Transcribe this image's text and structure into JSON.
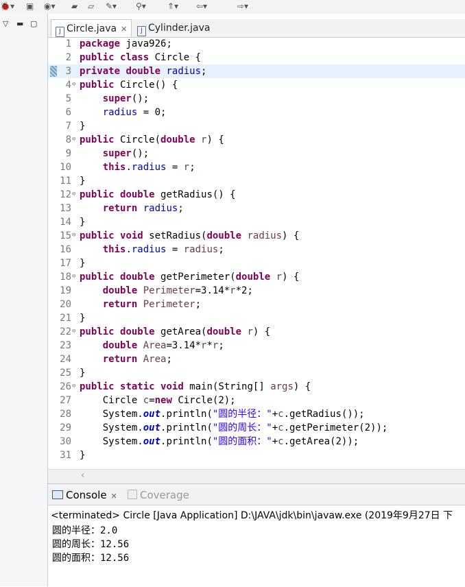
{
  "toolbar": {
    "icons": [
      "debug-icon",
      "package-icon",
      "run-icon",
      "open-folder-icon",
      "new-folder-icon",
      "tools-icon",
      "search-icon",
      "annotation-icon",
      "back-icon",
      "forward-icon"
    ]
  },
  "editor": {
    "tabs": [
      {
        "label": "Circle.java",
        "active": true
      },
      {
        "label": "Cylinder.java",
        "active": false
      }
    ],
    "highlighted_line": 3,
    "lines": [
      {
        "n": "1",
        "html": "<span class=\"k\">package</span> java926;"
      },
      {
        "n": "2",
        "html": "<span class=\"k\">public</span> <span class=\"k\">class</span> Circle {"
      },
      {
        "n": "3",
        "html": "<span class=\"k\">private</span> <span class=\"k\">double</span> <span class=\"f\">radius</span>;"
      },
      {
        "n": "4",
        "fold": true,
        "html": "<span class=\"k\">public</span> Circle() {"
      },
      {
        "n": "5",
        "html": "    <span class=\"k\">super</span>();"
      },
      {
        "n": "6",
        "html": "    <span class=\"f\">radius</span> = 0;"
      },
      {
        "n": "7",
        "html": "}"
      },
      {
        "n": "8",
        "fold": true,
        "html": "<span class=\"k\">public</span> Circle(<span class=\"k\">double</span> <span class=\"v\">r</span>) {"
      },
      {
        "n": "9",
        "html": "    <span class=\"k\">super</span>();"
      },
      {
        "n": "10",
        "html": "    <span class=\"k\">this</span>.<span class=\"f\">radius</span> = <span class=\"v\">r</span>;"
      },
      {
        "n": "11",
        "html": "}"
      },
      {
        "n": "12",
        "fold": true,
        "html": "<span class=\"k\">public</span> <span class=\"k\">double</span> getRadius() {"
      },
      {
        "n": "13",
        "html": "    <span class=\"k\">return</span> <span class=\"f\">radius</span>;"
      },
      {
        "n": "14",
        "html": "}"
      },
      {
        "n": "15",
        "fold": true,
        "html": "<span class=\"k\">public</span> <span class=\"k\">void</span> setRadius(<span class=\"k\">double</span> <span class=\"v\">radius</span>) {"
      },
      {
        "n": "16",
        "html": "    <span class=\"k\">this</span>.<span class=\"f\">radius</span> = <span class=\"v\">radius</span>;"
      },
      {
        "n": "17",
        "html": "}"
      },
      {
        "n": "18",
        "fold": true,
        "html": "<span class=\"k\">public</span> <span class=\"k\">double</span> getPerimeter(<span class=\"k\">double</span> <span class=\"v\">r</span>) {"
      },
      {
        "n": "19",
        "html": "    <span class=\"k\">double</span> <span class=\"v\">Perimeter</span>=3.14*<span class=\"v\">r</span>*2;"
      },
      {
        "n": "20",
        "html": "    <span class=\"k\">return</span> <span class=\"v\">Perimeter</span>;"
      },
      {
        "n": "21",
        "html": "}"
      },
      {
        "n": "22",
        "fold": true,
        "html": "<span class=\"k\">public</span> <span class=\"k\">double</span> getArea(<span class=\"k\">double</span> <span class=\"v\">r</span>) {"
      },
      {
        "n": "23",
        "html": "    <span class=\"k\">double</span> <span class=\"v\">Area</span>=3.14*<span class=\"v\">r</span>*<span class=\"v\">r</span>;"
      },
      {
        "n": "24",
        "html": "    <span class=\"k\">return</span> <span class=\"v\">Area</span>;"
      },
      {
        "n": "25",
        "html": "}"
      },
      {
        "n": "26",
        "fold": true,
        "html": "<span class=\"k\">public</span> <span class=\"k\">static</span> <span class=\"k\">void</span> main(String[] <span class=\"v\">args</span>) {"
      },
      {
        "n": "27",
        "html": "    Circle <span class=\"v\">c</span>=<span class=\"k\">new</span> Circle(2);"
      },
      {
        "n": "28",
        "html": "    System.<span class=\"o\">out</span>.println(<span class=\"s\">\"圆的半径：\"</span>+<span class=\"v\">c</span>.getRadius());"
      },
      {
        "n": "29",
        "html": "    System.<span class=\"o\">out</span>.println(<span class=\"s\">\"圆的周长：\"</span>+<span class=\"v\">c</span>.getPerimeter(2));"
      },
      {
        "n": "30",
        "html": "    System.<span class=\"o\">out</span>.println(<span class=\"s\">\"圆的面积：\"</span>+<span class=\"v\">c</span>.getArea(2));"
      },
      {
        "n": "31",
        "html": "}"
      }
    ]
  },
  "console": {
    "tabs": [
      {
        "label": "Console",
        "active": true
      },
      {
        "label": "Coverage",
        "active": false
      }
    ],
    "status": "<terminated> Circle [Java Application] D:\\JAVA\\jdk\\bin\\javaw.exe (2019年9月27日 下",
    "output": [
      "圆的半径：2.0",
      "圆的周长：12.56",
      "圆的面积：12.56"
    ]
  },
  "colors": {
    "keyword": "#7f0055",
    "field": "#0000c0",
    "local_var": "#6a3e3e",
    "string": "#2a00ff",
    "line_highlight": "#e8f2fe"
  }
}
